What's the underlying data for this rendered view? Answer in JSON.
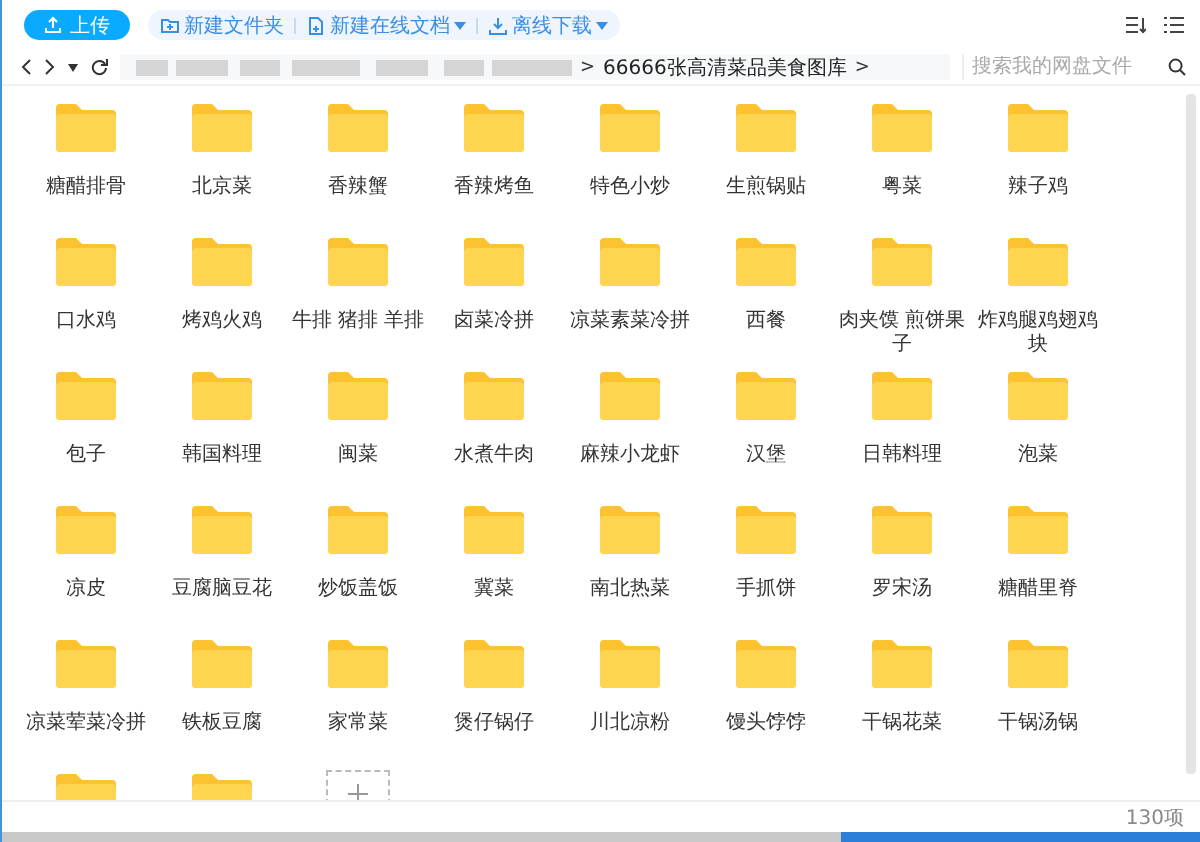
{
  "toolbar": {
    "upload_button": {
      "label": "上传"
    },
    "actions": [
      {
        "kind": "folder",
        "label": "新建文件夹",
        "dropdown": false
      },
      {
        "kind": "doc",
        "label": "新建在线文档",
        "dropdown": true
      },
      {
        "kind": "download",
        "label": "离线下载",
        "dropdown": true
      }
    ]
  },
  "nav": {
    "breadcrumb": {
      "current": "66666张高清菜品美食图库",
      "separator_before": ">",
      "separator_after": ">"
    },
    "search": {
      "placeholder": "搜索我的网盘文件"
    }
  },
  "items": [
    {
      "kind": "folder",
      "name": "糖醋排骨"
    },
    {
      "kind": "folder",
      "name": "北京菜"
    },
    {
      "kind": "folder",
      "name": "香辣蟹"
    },
    {
      "kind": "folder",
      "name": "香辣烤鱼"
    },
    {
      "kind": "folder",
      "name": "特色小炒"
    },
    {
      "kind": "folder",
      "name": "生煎锅贴"
    },
    {
      "kind": "folder",
      "name": "粤菜"
    },
    {
      "kind": "folder",
      "name": "辣子鸡"
    },
    {
      "kind": "folder",
      "name": "口水鸡"
    },
    {
      "kind": "folder",
      "name": "烤鸡火鸡"
    },
    {
      "kind": "folder",
      "name": "牛排 猪排 羊排"
    },
    {
      "kind": "folder",
      "name": "卤菜冷拼"
    },
    {
      "kind": "folder",
      "name": "凉菜素菜冷拼"
    },
    {
      "kind": "folder",
      "name": "西餐"
    },
    {
      "kind": "folder",
      "name": "肉夹馍 煎饼果子"
    },
    {
      "kind": "folder",
      "name": "炸鸡腿鸡翅鸡块"
    },
    {
      "kind": "folder",
      "name": "包子"
    },
    {
      "kind": "folder",
      "name": "韩国料理"
    },
    {
      "kind": "folder",
      "name": "闽菜"
    },
    {
      "kind": "folder",
      "name": "水煮牛肉"
    },
    {
      "kind": "folder",
      "name": "麻辣小龙虾"
    },
    {
      "kind": "folder",
      "name": "汉堡"
    },
    {
      "kind": "folder",
      "name": "日韩料理"
    },
    {
      "kind": "folder",
      "name": "泡菜"
    },
    {
      "kind": "folder",
      "name": "凉皮"
    },
    {
      "kind": "folder",
      "name": "豆腐脑豆花"
    },
    {
      "kind": "folder",
      "name": "炒饭盖饭"
    },
    {
      "kind": "folder",
      "name": "冀菜"
    },
    {
      "kind": "folder",
      "name": "南北热菜"
    },
    {
      "kind": "folder",
      "name": "手抓饼"
    },
    {
      "kind": "folder",
      "name": "罗宋汤"
    },
    {
      "kind": "folder",
      "name": "糖醋里脊"
    },
    {
      "kind": "folder",
      "name": "凉菜荤菜冷拼"
    },
    {
      "kind": "folder",
      "name": "铁板豆腐"
    },
    {
      "kind": "folder",
      "name": "家常菜"
    },
    {
      "kind": "folder",
      "name": "煲仔锅仔"
    },
    {
      "kind": "folder",
      "name": "川北凉粉"
    },
    {
      "kind": "folder",
      "name": "馒头饽饽"
    },
    {
      "kind": "folder",
      "name": "干锅花菜"
    },
    {
      "kind": "folder",
      "name": "干锅汤锅"
    },
    {
      "kind": "folder"
    },
    {
      "kind": "folder"
    },
    {
      "kind": "add"
    }
  ],
  "status_bar": {
    "count": "130项"
  }
}
